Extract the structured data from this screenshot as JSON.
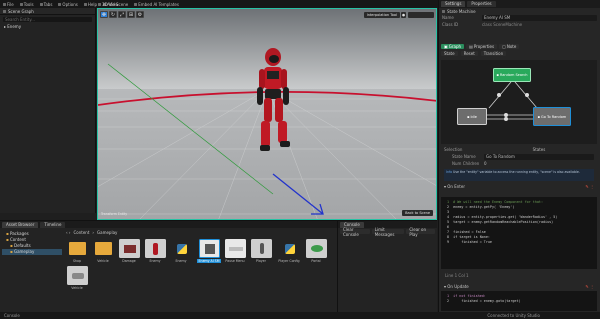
{
  "menubar": {
    "items": [
      {
        "label": "File"
      },
      {
        "label": "Tools"
      },
      {
        "label": "Tabs"
      },
      {
        "label": "Options"
      },
      {
        "label": "Help"
      },
      {
        "label": "Add Scene"
      },
      {
        "label": "Embed AI Templates"
      }
    ]
  },
  "scene_graph": {
    "title": "Scene Graph",
    "search_placeholder": "Search Entity...",
    "items": [
      {
        "label": "Enemy"
      }
    ]
  },
  "viewport": {
    "tab": "3D View",
    "tools": [
      "✥",
      "↻",
      "⤢",
      "⊞",
      "⚙"
    ],
    "interp_tool": "Interpolation Tool",
    "back_btn": "Back to Scene",
    "caption": "Transform Entity"
  },
  "right_panel": {
    "tabs": [
      {
        "label": "Settings"
      },
      {
        "label": "Properties"
      }
    ],
    "heading": "State Machine",
    "name_label": "Name",
    "name_value": "Enemy AI SM",
    "class_label": "Class ID",
    "class_value": "class SceneMachine",
    "graph_tabs": [
      {
        "label": "Graph"
      },
      {
        "label": "Properties"
      },
      {
        "label": "Note"
      }
    ],
    "graph_toolbar": [
      {
        "label": "State"
      },
      {
        "label": "Reset"
      },
      {
        "label": "Transition"
      }
    ],
    "nodes": [
      {
        "label": "Random Search"
      },
      {
        "label": "Idle"
      },
      {
        "label": "Go To Random"
      }
    ],
    "selection_label": "Selection",
    "selection_value": "States",
    "state_name_label": "State Name",
    "state_name_value": "Go To Random",
    "num_children_label": "Num Children",
    "num_children_value": "0",
    "hint": "Use the \"entity\" variable to access the running entity, \"scene\" is also available.",
    "on_enter_label": "On Enter",
    "on_update_label": "On Update",
    "code_lines": [
      " 1  # We will need the Enemy Component for that:",
      " 2  enemy = entity.getPy( 'Enemy')",
      " 3  ",
      " 4  radius = entity.properties.get( 'WanderRadius' , 5)",
      " 5  target = enemy.getRandomReachablePosition(radius)",
      " 6  ",
      " 7  finished = False",
      " 8  if target is None:",
      " 9      finished = True"
    ],
    "update_lines": [
      " 1  if not finished:",
      " 2      finished = enemy.goto(target)"
    ],
    "tree_label": "Line 1 Col 1"
  },
  "bottom": {
    "tabs": [
      {
        "label": "Asset Browser"
      },
      {
        "label": "Timeline"
      }
    ],
    "tree": [
      {
        "label": "Packages"
      },
      {
        "label": "Content"
      },
      {
        "label": "Defaults"
      },
      {
        "label": "Gameplay"
      }
    ],
    "breadcrumb": [
      "Content",
      "Gameplay"
    ],
    "assets": [
      {
        "label": "Shop",
        "kind": "folder"
      },
      {
        "label": "Vehicle",
        "kind": "folder"
      },
      {
        "label": "Damage",
        "kind": "mesh"
      },
      {
        "label": "Enemy",
        "kind": "mesh"
      },
      {
        "label": "Enemy",
        "kind": "python"
      },
      {
        "label": "Enemy AI SM",
        "kind": "sm"
      },
      {
        "label": "Pause Menu",
        "kind": "ui"
      },
      {
        "label": "Player",
        "kind": "mesh"
      },
      {
        "label": "Player Config",
        "kind": "python"
      },
      {
        "label": "Portal",
        "kind": "mesh"
      },
      {
        "label": "Vehicle",
        "kind": "mesh"
      }
    ],
    "console_tab": "Console",
    "console_buttons": [
      {
        "label": "Clear Console"
      },
      {
        "label": "Limit Messages"
      },
      {
        "label": "Clear on Play"
      }
    ]
  },
  "status": {
    "left": "Console",
    "right": "Connected to Unity Studio"
  },
  "colors": {
    "accent": "#27c2a5",
    "node_green": "#29a95c",
    "node_blue": "#1f8fd8"
  }
}
